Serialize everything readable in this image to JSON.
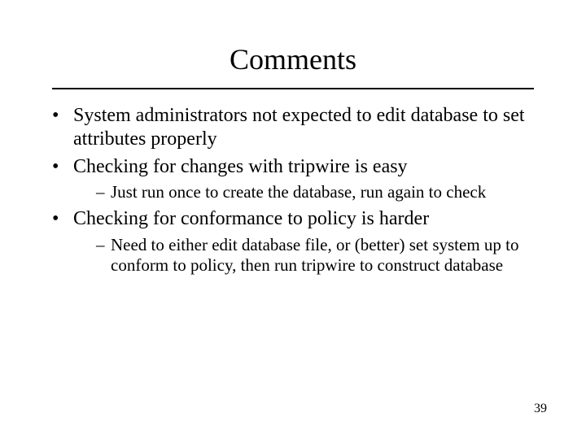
{
  "slide": {
    "title": "Comments",
    "bullets": [
      {
        "text": "System administrators not expected to edit database to set attributes properly",
        "sub": []
      },
      {
        "text": "Checking for changes with tripwire is easy",
        "sub": [
          {
            "text": "Just run once to create the database, run again to check"
          }
        ]
      },
      {
        "text": "Checking for conformance to policy is harder",
        "sub": [
          {
            "text": "Need to either edit database file, or (better) set system up to conform to policy, then run tripwire to construct database"
          }
        ]
      }
    ],
    "page_number": "39"
  }
}
